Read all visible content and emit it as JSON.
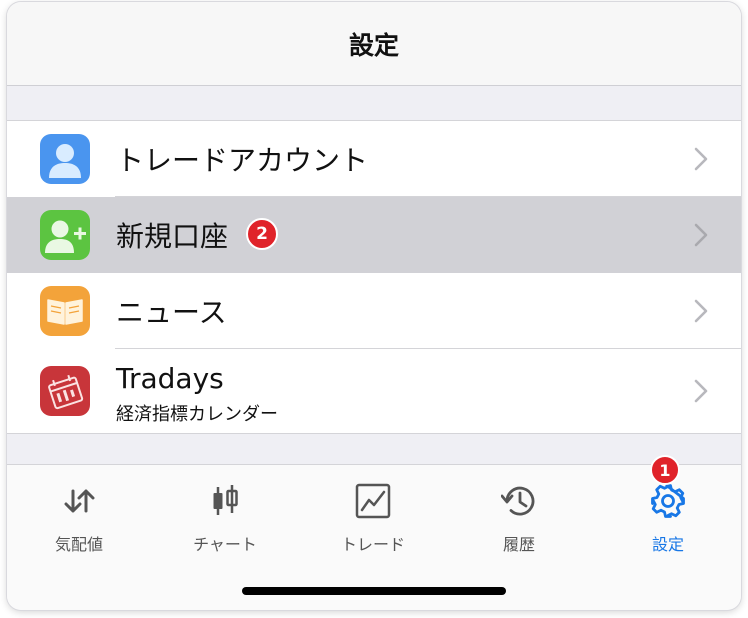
{
  "header": {
    "title": "設定"
  },
  "settings": {
    "items": [
      {
        "label": "トレードアカウント",
        "icon": "person-icon",
        "icon_color": "#4a95ef"
      },
      {
        "label": "新規口座",
        "icon": "add-person-icon",
        "icon_color": "#5cc441",
        "badge": "2",
        "selected": true
      },
      {
        "label": "ニュース",
        "icon": "book-icon",
        "icon_color": "#f3a33a"
      },
      {
        "label": "Tradays",
        "sublabel": "経済指標カレンダー",
        "icon": "calendar-icon",
        "icon_color": "#c8353a"
      }
    ]
  },
  "tabbar": {
    "tabs": [
      {
        "label": "気配値",
        "icon": "quotes-arrows-icon"
      },
      {
        "label": "チャート",
        "icon": "candlestick-icon"
      },
      {
        "label": "トレード",
        "icon": "trade-chart-icon"
      },
      {
        "label": "履歴",
        "icon": "history-icon"
      },
      {
        "label": "設定",
        "icon": "gear-icon",
        "active": true,
        "badge": "1"
      }
    ],
    "active_color": "#1877e6",
    "inactive_color": "#555555"
  },
  "colors": {
    "badge": "#e0232a",
    "selected_row": "#d1d1d6"
  }
}
